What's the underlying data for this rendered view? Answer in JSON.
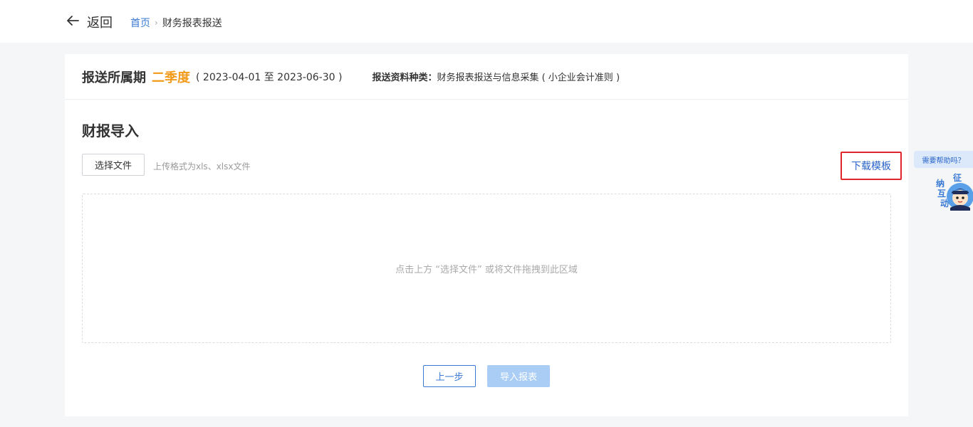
{
  "header": {
    "back_label": "返回",
    "breadcrumb": {
      "home": "首页",
      "separator": "›",
      "current": "财务报表报送"
    }
  },
  "period": {
    "label": "报送所属期",
    "value": "二季度",
    "range": "( 2023-04-01 至 2023-06-30 )",
    "material_label": "报送资料种类：",
    "material_value": "财务报表报送与信息采集 ( 小企业会计准则 )"
  },
  "import": {
    "title": "财报导入",
    "choose_file": "选择文件",
    "hint": "上传格式为xls、xlsx文件",
    "download_template": "下载模板",
    "dropzone_text": "点击上方 “选择文件” 或将文件拖拽到此区域"
  },
  "actions": {
    "prev": "上一步",
    "import": "导入报表"
  },
  "help": {
    "bubble": "需要帮助吗？",
    "assistant_chars": [
      "征",
      "纳",
      "互",
      "动"
    ]
  },
  "colors": {
    "accent": "#3a7ad5",
    "season": "#f29a1a",
    "highlight_border": "#e0262a",
    "disabled_button": "#a9cdf5"
  }
}
